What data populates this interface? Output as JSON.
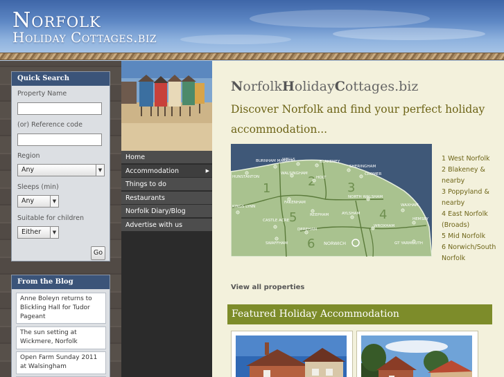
{
  "site": {
    "logo_line1": "Norfolk",
    "logo_line2": "Holiday Cottages.biz"
  },
  "quick_search": {
    "title": "Quick Search",
    "property_name_label": "Property Name",
    "property_name_value": "",
    "ref_label": "(or) Reference code",
    "ref_value": "",
    "region_label": "Region",
    "region_value": "Any",
    "sleeps_label": "Sleeps (min)",
    "sleeps_value": "Any",
    "children_label": "Suitable for children",
    "children_value": "Either",
    "go_label": "Go"
  },
  "blog": {
    "title": "From the Blog",
    "items": [
      "Anne Boleyn returns to Blickling Hall for Tudor Pageant",
      "The sun setting at Wickmere, Norfolk",
      "Open Farm Sunday 2011 at Walsingham"
    ]
  },
  "nav": {
    "items": [
      "Home",
      "Accommodation",
      "Things to do",
      "Restaurants",
      "Norfolk Diary/Blog",
      "Advertise with us"
    ]
  },
  "main": {
    "title_N": "N",
    "title_orfolk": "orfolk",
    "title_H": "H",
    "title_oliday": "oliday",
    "title_C": "C",
    "title_ottages": "ottages.biz",
    "tagline": "Discover Norfolk and find your perfect holiday accommodation...",
    "view_all": "View all properties",
    "featured_title": "Featured Holiday Accommodation"
  },
  "map": {
    "towns": [
      "BURNHAM MARKET",
      "WELLS",
      "BLAKENEY",
      "SHERINGHAM",
      "CROMER",
      "WALSINGHAM",
      "HOLT",
      "HUNSTANTON",
      "NORTH WALSHAM",
      "FAKENHAM",
      "WAXHAM",
      "KINGS LYNN",
      "AYLSHAM",
      "REEPHAM",
      "HEMSBY",
      "CASTLE ACRE",
      "WROXHAM",
      "DEREHAM",
      "SWAFFHAM",
      "NORWICH",
      "GT YARMOUTH"
    ],
    "region_numbers": [
      "1",
      "2",
      "3",
      "4",
      "5",
      "6"
    ]
  },
  "legend": [
    "1 West Norfolk",
    "2 Blakeney & nearby",
    "3 Poppyland & nearby",
    "4 East Norfolk (Broads)",
    "5 Mid Norfolk",
    "6 Norwich/South Norfolk"
  ],
  "colors": {
    "header_blue": "#4a72b3",
    "sidebar_navy": "#3b5479",
    "olive": "#7d8c2a",
    "olive_text": "#6d6417",
    "nav_dark": "#4d4d4d",
    "map_land": "#a9c28f",
    "map_sea": "#3f5878"
  }
}
